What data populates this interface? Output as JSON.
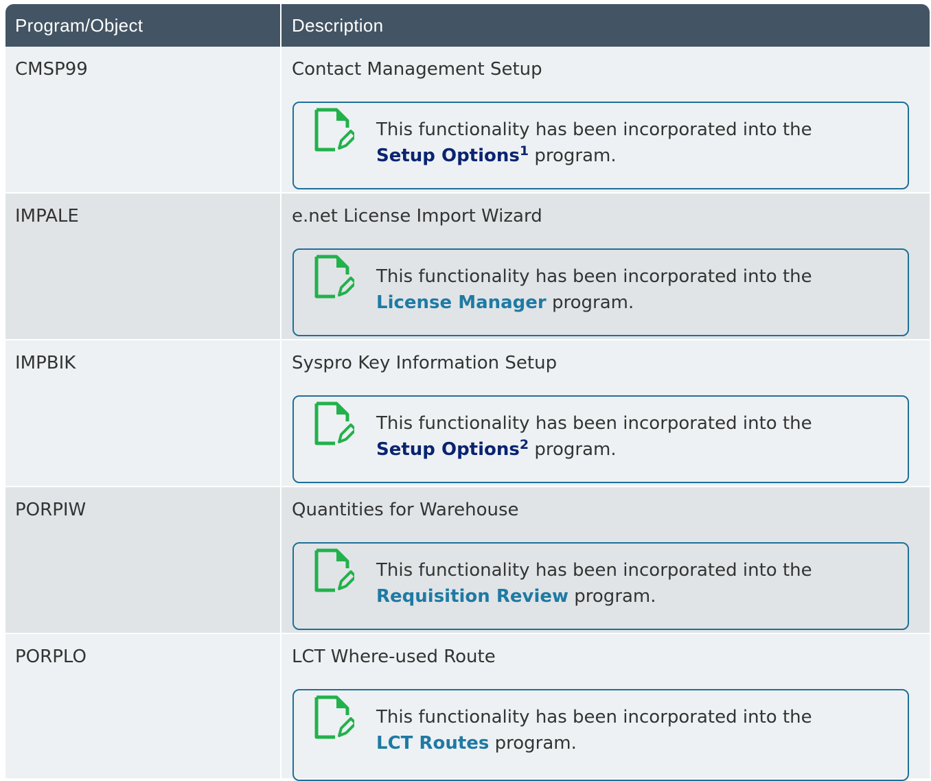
{
  "table": {
    "headers": {
      "col1": "Program/Object",
      "col2": "Description"
    },
    "note_prefix": "This functionality has been incorporated into the",
    "note_suffix": "program.",
    "rows": [
      {
        "program": "CMSP99",
        "description": "Contact Management Setup",
        "link": "Setup Options",
        "superscript": "1",
        "link_style": "navy"
      },
      {
        "program": "IMPALE",
        "description": "e.net License Import Wizard",
        "link": "License Manager",
        "superscript": "",
        "link_style": "teal"
      },
      {
        "program": "IMPBIK",
        "description": "Syspro Key Information Setup",
        "link": "Setup Options",
        "superscript": "2",
        "link_style": "navy"
      },
      {
        "program": "PORPIW",
        "description": "Quantities for Warehouse",
        "link": "Requisition Review",
        "superscript": "",
        "link_style": "teal"
      },
      {
        "program": "PORPLO",
        "description": "LCT Where-used Route",
        "link": "LCT Routes",
        "superscript": "",
        "link_style": "teal"
      }
    ]
  },
  "colors": {
    "header_bg": "#435464",
    "row_odd": "#edf1f3",
    "row_even": "#e0e4e7",
    "note_border": "#1e6f97",
    "icon_green": "#22b14c",
    "link_navy": "#0a2470",
    "link_teal": "#1f7aa3"
  },
  "icons": {
    "note": "note-edit-icon"
  }
}
